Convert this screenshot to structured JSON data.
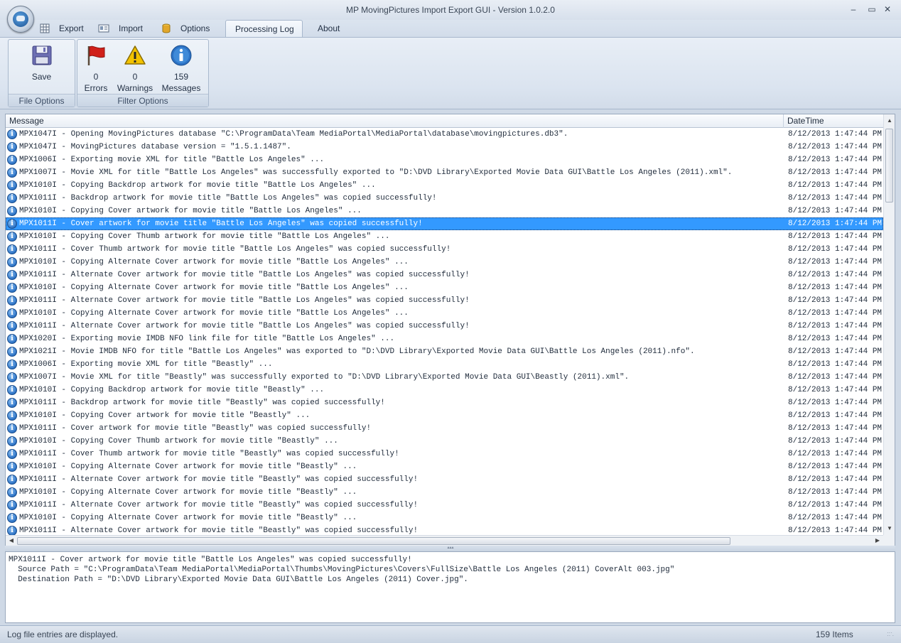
{
  "window": {
    "title": "MP MovingPictures Import Export GUI - Version 1.0.2.0",
    "minimize": "–",
    "maximize": "▭",
    "close": "✕"
  },
  "tabs": [
    {
      "label": "Export",
      "icon": "spreadsheet-icon"
    },
    {
      "label": "Import",
      "icon": "id-card-icon"
    },
    {
      "label": "Options",
      "icon": "database-icon"
    },
    {
      "label": "Processing Log",
      "icon": ""
    },
    {
      "label": "About",
      "icon": ""
    }
  ],
  "active_tab": "Processing Log",
  "ribbon": {
    "file_options": {
      "label": "File Options",
      "save_label": "Save"
    },
    "filter_options": {
      "label": "Filter Options",
      "errors_count": "0",
      "errors_label": "Errors",
      "warnings_count": "0",
      "warnings_label": "Warnings",
      "messages_count": "159",
      "messages_label": "Messages"
    }
  },
  "grid": {
    "columns": {
      "message": "Message",
      "datetime": "DateTime"
    },
    "selected_index": 7,
    "rows": [
      {
        "message": "MPX1047I - Opening MovingPictures database \"C:\\ProgramData\\Team MediaPortal\\MediaPortal\\database\\movingpictures.db3\".",
        "datetime": "8/12/2013 1:47:44 PM"
      },
      {
        "message": "MPX1047I - MovingPictures database version = \"1.5.1.1487\".",
        "datetime": "8/12/2013 1:47:44 PM"
      },
      {
        "message": "MPX1006I - Exporting movie XML for title \"Battle Los Angeles\" ...",
        "datetime": "8/12/2013 1:47:44 PM"
      },
      {
        "message": "MPX1007I - Movie XML for title \"Battle Los Angeles\" was successfully exported to \"D:\\DVD Library\\Exported Movie Data GUI\\Battle Los Angeles (2011).xml\".",
        "datetime": "8/12/2013 1:47:44 PM"
      },
      {
        "message": "MPX1010I - Copying Backdrop artwork for movie title \"Battle Los Angeles\" ...",
        "datetime": "8/12/2013 1:47:44 PM"
      },
      {
        "message": "MPX1011I - Backdrop artwork for movie title \"Battle Los Angeles\" was copied successfully!",
        "datetime": "8/12/2013 1:47:44 PM"
      },
      {
        "message": "MPX1010I - Copying Cover artwork for movie title \"Battle Los Angeles\" ...",
        "datetime": "8/12/2013 1:47:44 PM"
      },
      {
        "message": "MPX1011I - Cover artwork for movie title \"Battle Los Angeles\" was copied successfully!",
        "datetime": "8/12/2013 1:47:44 PM"
      },
      {
        "message": "MPX1010I - Copying Cover Thumb artwork for movie title \"Battle Los Angeles\" ...",
        "datetime": "8/12/2013 1:47:44 PM"
      },
      {
        "message": "MPX1011I - Cover Thumb artwork for movie title \"Battle Los Angeles\" was copied successfully!",
        "datetime": "8/12/2013 1:47:44 PM"
      },
      {
        "message": "MPX1010I - Copying Alternate Cover artwork for movie title \"Battle Los Angeles\" ...",
        "datetime": "8/12/2013 1:47:44 PM"
      },
      {
        "message": "MPX1011I - Alternate Cover artwork for movie title \"Battle Los Angeles\" was copied successfully!",
        "datetime": "8/12/2013 1:47:44 PM"
      },
      {
        "message": "MPX1010I - Copying Alternate Cover artwork for movie title \"Battle Los Angeles\" ...",
        "datetime": "8/12/2013 1:47:44 PM"
      },
      {
        "message": "MPX1011I - Alternate Cover artwork for movie title \"Battle Los Angeles\" was copied successfully!",
        "datetime": "8/12/2013 1:47:44 PM"
      },
      {
        "message": "MPX1010I - Copying Alternate Cover artwork for movie title \"Battle Los Angeles\" ...",
        "datetime": "8/12/2013 1:47:44 PM"
      },
      {
        "message": "MPX1011I - Alternate Cover artwork for movie title \"Battle Los Angeles\" was copied successfully!",
        "datetime": "8/12/2013 1:47:44 PM"
      },
      {
        "message": "MPX1020I - Exporting movie IMDB NFO link file for title \"Battle Los Angeles\" ...",
        "datetime": "8/12/2013 1:47:44 PM"
      },
      {
        "message": "MPX1021I - Movie IMDB NFO for title \"Battle Los Angeles\" was exported to \"D:\\DVD Library\\Exported Movie Data GUI\\Battle Los Angeles (2011).nfo\".",
        "datetime": "8/12/2013 1:47:44 PM"
      },
      {
        "message": "MPX1006I - Exporting movie XML for title \"Beastly\" ...",
        "datetime": "8/12/2013 1:47:44 PM"
      },
      {
        "message": "MPX1007I - Movie XML for title \"Beastly\" was successfully exported to \"D:\\DVD Library\\Exported Movie Data GUI\\Beastly (2011).xml\".",
        "datetime": "8/12/2013 1:47:44 PM"
      },
      {
        "message": "MPX1010I - Copying Backdrop artwork for movie title \"Beastly\" ...",
        "datetime": "8/12/2013 1:47:44 PM"
      },
      {
        "message": "MPX1011I - Backdrop artwork for movie title \"Beastly\" was copied successfully!",
        "datetime": "8/12/2013 1:47:44 PM"
      },
      {
        "message": "MPX1010I - Copying Cover artwork for movie title \"Beastly\" ...",
        "datetime": "8/12/2013 1:47:44 PM"
      },
      {
        "message": "MPX1011I - Cover artwork for movie title \"Beastly\" was copied successfully!",
        "datetime": "8/12/2013 1:47:44 PM"
      },
      {
        "message": "MPX1010I - Copying Cover Thumb artwork for movie title \"Beastly\" ...",
        "datetime": "8/12/2013 1:47:44 PM"
      },
      {
        "message": "MPX1011I - Cover Thumb artwork for movie title \"Beastly\" was copied successfully!",
        "datetime": "8/12/2013 1:47:44 PM"
      },
      {
        "message": "MPX1010I - Copying Alternate Cover artwork for movie title \"Beastly\" ...",
        "datetime": "8/12/2013 1:47:44 PM"
      },
      {
        "message": "MPX1011I - Alternate Cover artwork for movie title \"Beastly\" was copied successfully!",
        "datetime": "8/12/2013 1:47:44 PM"
      },
      {
        "message": "MPX1010I - Copying Alternate Cover artwork for movie title \"Beastly\" ...",
        "datetime": "8/12/2013 1:47:44 PM"
      },
      {
        "message": "MPX1011I - Alternate Cover artwork for movie title \"Beastly\" was copied successfully!",
        "datetime": "8/12/2013 1:47:44 PM"
      },
      {
        "message": "MPX1010I - Copying Alternate Cover artwork for movie title \"Beastly\" ...",
        "datetime": "8/12/2013 1:47:44 PM"
      },
      {
        "message": "MPX1011I - Alternate Cover artwork for movie title \"Beastly\" was copied successfully!",
        "datetime": "8/12/2013 1:47:44 PM"
      }
    ]
  },
  "details": {
    "line1": "MPX1011I - Cover artwork for movie title \"Battle Los Angeles\" was copied successfully!",
    "line2": "  Source Path = \"C:\\ProgramData\\Team MediaPortal\\MediaPortal\\Thumbs\\MovingPictures\\Covers\\FullSize\\Battle Los Angeles (2011) CoverAlt 003.jpg\"",
    "line3": "  Destination Path = \"D:\\DVD Library\\Exported Movie Data GUI\\Battle Los Angeles (2011) Cover.jpg\"."
  },
  "status": {
    "left": "Log file entries are displayed.",
    "right": "159 Items"
  },
  "colors": {
    "selection": "#3399ff",
    "info_icon": "#2c72c5",
    "error_flag": "#d0201a",
    "warning": "#f2c200"
  }
}
